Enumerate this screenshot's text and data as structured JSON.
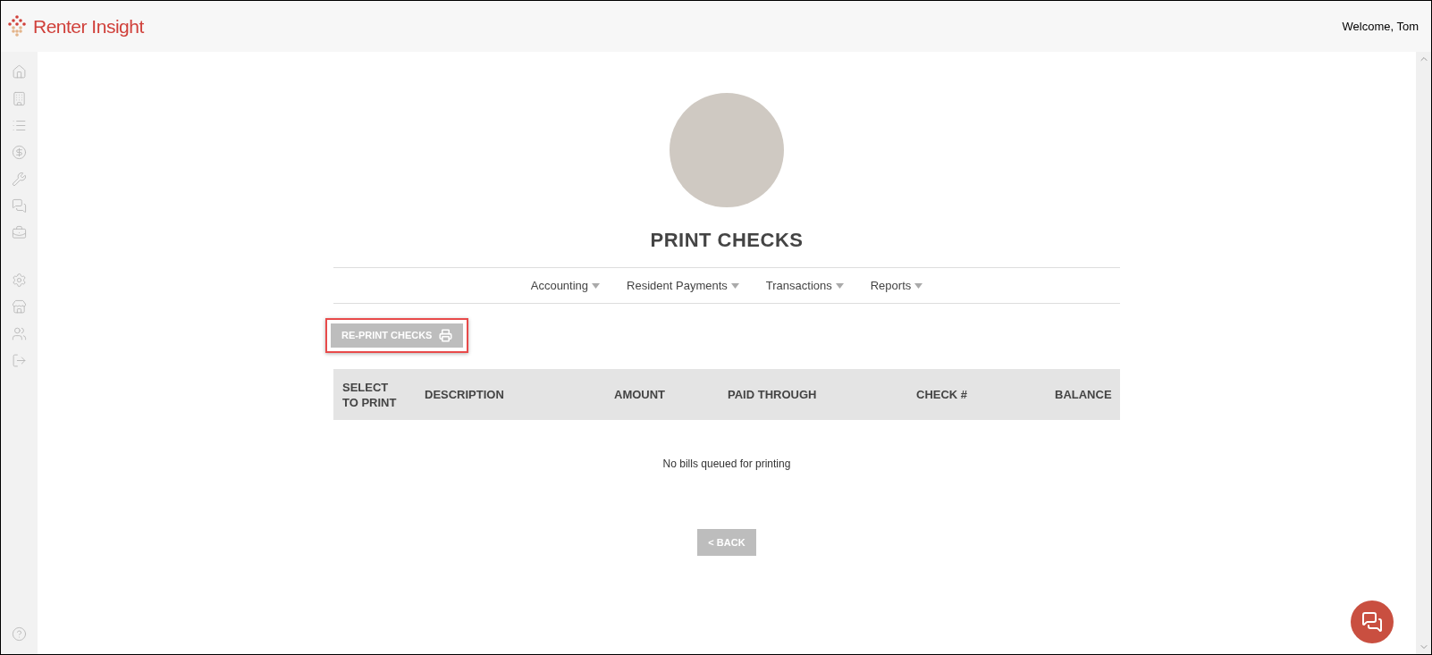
{
  "header": {
    "brand": "Renter Insight",
    "welcome": "Welcome, Tom"
  },
  "page": {
    "title": "PRINT CHECKS"
  },
  "nav": [
    {
      "label": "Accounting"
    },
    {
      "label": "Resident Payments"
    },
    {
      "label": "Transactions"
    },
    {
      "label": "Reports"
    }
  ],
  "reprint_button": {
    "label": "RE-PRINT CHECKS"
  },
  "table": {
    "columns": [
      "SELECT TO PRINT",
      "DESCRIPTION",
      "AMOUNT",
      "PAID THROUGH",
      "CHECK #",
      "BALANCE"
    ],
    "empty_message": "No bills queued for printing"
  },
  "back_button": {
    "label": "< BACK"
  }
}
